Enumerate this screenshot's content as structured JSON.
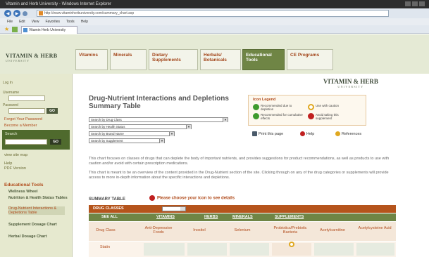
{
  "browser": {
    "title": "Vitamin and Herb University - Windows Internet Explorer",
    "url": "http://www.vitaminherbuniversity.com/summary_chart.asp",
    "menu": [
      "File",
      "Edit",
      "View",
      "Favorites",
      "Tools",
      "Help"
    ],
    "tab_label": "Vitamin Herb University"
  },
  "site": {
    "logo_line1": "VITAMIN & HERB",
    "logo_line2": "UNIVERSITY",
    "nav_tabs": [
      {
        "label": "Vitamins"
      },
      {
        "label": "Minerals"
      },
      {
        "label": "Dietary Supplements"
      },
      {
        "label": "Herbals/ Botanicals"
      },
      {
        "label": "Educational Tools"
      },
      {
        "label": "CE Programs"
      }
    ]
  },
  "sidebar": {
    "login": "Log In",
    "username_label": "Username",
    "password_label": "Password",
    "go_label": "GO",
    "forgot": "Forgot Your Password",
    "become_member": "Become a Member",
    "search_label": "Search",
    "site_map": "view site map",
    "help": "Help",
    "pdf": "PDF Version",
    "section_title": "Educational Tools",
    "items": [
      "Wellness Wheel",
      "Nutrition & Health Status Tables",
      "Drug-Nutrient Interactions & Depletions Table",
      "Supplement Dosage Chart",
      "Herbal Dosage Chart"
    ]
  },
  "main": {
    "title": "Drug-Nutrient Interactions and Depletions Summary Table",
    "selects": [
      "Search by Drug Class",
      "Search by Health Status",
      "Search by Brand Name",
      "Search by Supplement"
    ],
    "legend": {
      "title": "Icon Legend",
      "items": [
        {
          "label": "Recommended due to depletion",
          "color": "#3e9b2e"
        },
        {
          "label": "Recommended for cumulative effects",
          "color": "#3e9b2e"
        },
        {
          "label": "Use with caution",
          "color": "#e0a820"
        },
        {
          "label": "Avoid taking this supplement",
          "color": "#c02020"
        }
      ]
    },
    "tools": {
      "print": "Print this page",
      "help": "Help",
      "references": "References"
    },
    "para1": "This chart focuses on classes of drugs that can deplete the body of important nutrients, and provides suggestions for product recommendations, as well as products to use with caution and/or avoid with certain prescription medications.",
    "para2": "This chart is meant to be an overview of the content provided in the Drug-Nutrient section of the site. Clicking through on any of the drug categories or supplements will provide access to more in-depth information about the specific interactions and depletions.",
    "summary_label": "SUMMARY TABLE",
    "notice": "Please choose your icon to see details",
    "table": {
      "bar_label": "DRUG CLASSES",
      "filters": [
        "SEE ALL",
        "VITAMINS",
        "HERBS",
        "MINERALS",
        "SUPPLEMENTS"
      ],
      "headers": [
        "Drug Class",
        "Anti-Depressive Foods",
        "Inositol",
        "Selenium",
        "Probiotics/Prebiotic Bacteria",
        "Acetylcarnitine",
        "Acetylcysteine Acid"
      ],
      "rows": [
        {
          "drug": "Statin"
        }
      ]
    }
  }
}
